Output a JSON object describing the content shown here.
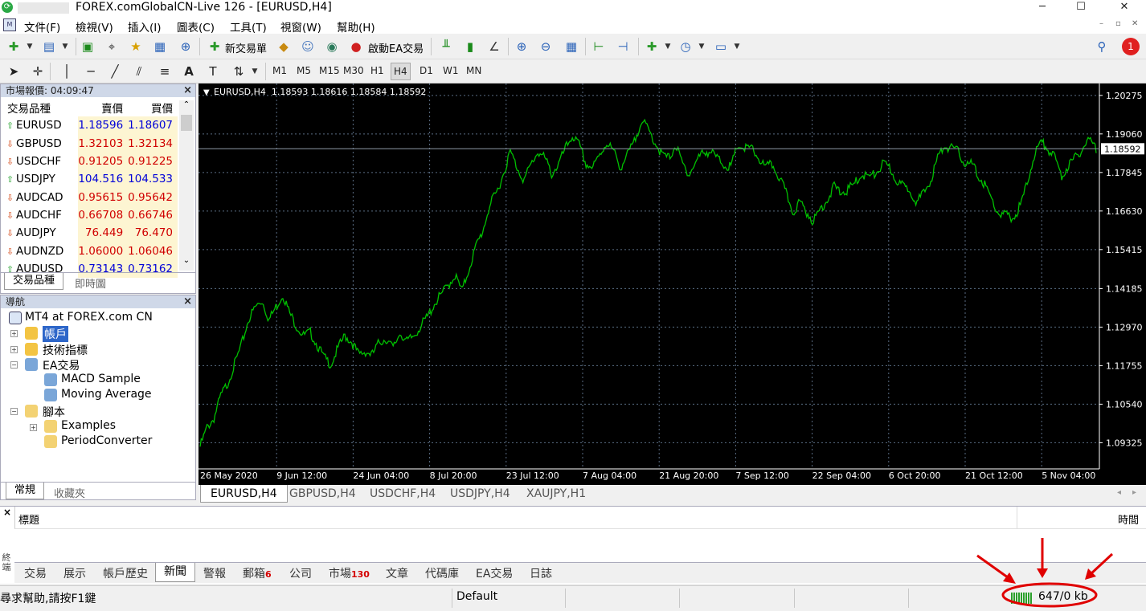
{
  "window": {
    "title": "FOREX.comGlobalCN-Live 126 - [EURUSD,H4]",
    "controls": [
      "─",
      "☐",
      "✕"
    ]
  },
  "menu": [
    "文件(F)",
    "檢視(V)",
    "插入(I)",
    "圖表(C)",
    "工具(T)",
    "視窗(W)",
    "幫助(H)"
  ],
  "toolbar": {
    "new_order": "新交易單",
    "auto_trading": "啟動EA交易",
    "notification_count": "1"
  },
  "timeframes": [
    "M1",
    "M5",
    "M15",
    "M30",
    "H1",
    "H4",
    "D1",
    "W1",
    "MN"
  ],
  "timeframe_selected": "H4",
  "market_watch": {
    "title": "市場報價: 04:09:47",
    "columns": [
      "交易品種",
      "賣價",
      "買價"
    ],
    "rows": [
      {
        "symbol": "EURUSD",
        "bid": "1.18596",
        "ask": "1.18607",
        "dir": "up"
      },
      {
        "symbol": "GBPUSD",
        "bid": "1.32103",
        "ask": "1.32134",
        "dir": "dn"
      },
      {
        "symbol": "USDCHF",
        "bid": "0.91205",
        "ask": "0.91225",
        "dir": "dn"
      },
      {
        "symbol": "USDJPY",
        "bid": "104.516",
        "ask": "104.533",
        "dir": "up"
      },
      {
        "symbol": "AUDCAD",
        "bid": "0.95615",
        "ask": "0.95642",
        "dir": "dn"
      },
      {
        "symbol": "AUDCHF",
        "bid": "0.66708",
        "ask": "0.66746",
        "dir": "dn"
      },
      {
        "symbol": "AUDJPY",
        "bid": "76.449",
        "ask": "76.470",
        "dir": "dn"
      },
      {
        "symbol": "AUDNZD",
        "bid": "1.06000",
        "ask": "1.06046",
        "dir": "dn"
      },
      {
        "symbol": "AUDUSD",
        "bid": "0.73143",
        "ask": "0.73162",
        "dir": "up"
      }
    ],
    "tabs": [
      "交易品種",
      "即時圖"
    ]
  },
  "navigator": {
    "title": "導航",
    "root": "MT4 at FOREX.com CN",
    "items": [
      "帳戶",
      "技術指標",
      "EA交易",
      "MACD Sample",
      "Moving Average",
      "腳本",
      "Examples",
      "PeriodConverter"
    ],
    "tabs": [
      "常規",
      "收藏夾"
    ]
  },
  "chart": {
    "info": "EURUSD,H4  1.18593 1.18616 1.18584 1.18592",
    "price_tag": "1.18592",
    "tabs": [
      "EURUSD,H4",
      "GBPUSD,H4",
      "USDCHF,H4",
      "USDJPY,H4",
      "XAUJPY,H1"
    ]
  },
  "chart_data": {
    "type": "line",
    "title": "EURUSD,H4",
    "ylim": [
      1.085,
      1.2065
    ],
    "yticks": [
      "1.20275",
      "1.19060",
      "1.17845",
      "1.16630",
      "1.15415",
      "1.14185",
      "1.12970",
      "1.11755",
      "1.10540",
      "1.09325"
    ],
    "xticks": [
      "26 May 2020",
      "9 Jun 12:00",
      "24 Jun 04:00",
      "8 Jul 20:00",
      "23 Jul 12:00",
      "7 Aug 04:00",
      "21 Aug 20:00",
      "7 Sep 12:00",
      "22 Sep 04:00",
      "6 Oct 20:00",
      "21 Oct 12:00",
      "5 Nov 04:00"
    ],
    "last_price": 1.18592,
    "colors": {
      "background": "#000000",
      "line": "#00c000",
      "grid": "#5a6d84",
      "text": "#ffffff"
    },
    "series": [
      {
        "values": [
          1.092,
          1.098,
          1.101,
          1.108,
          1.112,
          1.118,
          1.124,
          1.132,
          1.136,
          1.138,
          1.132,
          1.136,
          1.14,
          1.134,
          1.13,
          1.127,
          1.128,
          1.124,
          1.12,
          1.118,
          1.123,
          1.127,
          1.125,
          1.121,
          1.122,
          1.121,
          1.125,
          1.126,
          1.123,
          1.128,
          1.125,
          1.127,
          1.13,
          1.133,
          1.137,
          1.14,
          1.143,
          1.146,
          1.141,
          1.148,
          1.155,
          1.16,
          1.168,
          1.172,
          1.178,
          1.185,
          1.18,
          1.176,
          1.181,
          1.185,
          1.183,
          1.178,
          1.181,
          1.186,
          1.19,
          1.187,
          1.181,
          1.18,
          1.184,
          1.188,
          1.185,
          1.18,
          1.184,
          1.188,
          1.195,
          1.192,
          1.188,
          1.184,
          1.183,
          1.187,
          1.181,
          1.178,
          1.182,
          1.185,
          1.185,
          1.183,
          1.181,
          1.18,
          1.187,
          1.186,
          1.186,
          1.183,
          1.18,
          1.181,
          1.177,
          1.172,
          1.166,
          1.169,
          1.166,
          1.163,
          1.167,
          1.17,
          1.174,
          1.172,
          1.173,
          1.175,
          1.178,
          1.177,
          1.178,
          1.181,
          1.18,
          1.176,
          1.174,
          1.173,
          1.169,
          1.172,
          1.176,
          1.183,
          1.187,
          1.186,
          1.185,
          1.181,
          1.181,
          1.177,
          1.174,
          1.169,
          1.165,
          1.165,
          1.164,
          1.168,
          1.175,
          1.184,
          1.188,
          1.186,
          1.183,
          1.177,
          1.181,
          1.183,
          1.186,
          1.189,
          1.186
        ]
      }
    ]
  },
  "terminal": {
    "columns": [
      "標題",
      "時間"
    ],
    "tabs": [
      {
        "label": "交易",
        "badge": ""
      },
      {
        "label": "展示",
        "badge": ""
      },
      {
        "label": "帳戶歷史",
        "badge": ""
      },
      {
        "label": "新聞",
        "badge": ""
      },
      {
        "label": "警報",
        "badge": ""
      },
      {
        "label": "郵箱",
        "badge": "6"
      },
      {
        "label": "公司",
        "badge": ""
      },
      {
        "label": "市場",
        "badge": "130"
      },
      {
        "label": "文章",
        "badge": ""
      },
      {
        "label": "代碼庫",
        "badge": ""
      },
      {
        "label": "EA交易",
        "badge": ""
      },
      {
        "label": "日誌",
        "badge": ""
      }
    ],
    "selected_tab": "新聞",
    "side_label": "終端"
  },
  "status": {
    "help": "尋求幫助,請按F1鍵",
    "profile": "Default",
    "traffic": "647/0 kb"
  }
}
